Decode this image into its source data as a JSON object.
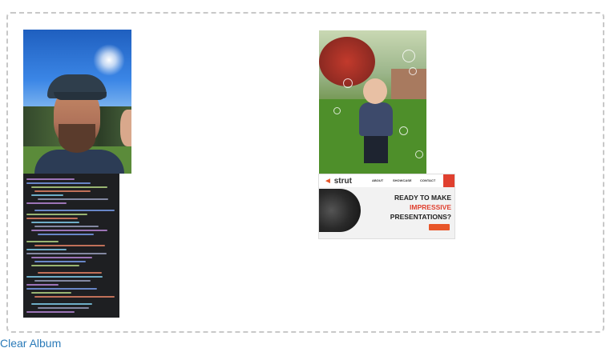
{
  "album": {
    "photos": [
      {
        "kind": "photo",
        "subject": "man-selfie"
      },
      {
        "kind": "photo",
        "subject": "toddler-bubbles"
      },
      {
        "kind": "screenshot",
        "subject": "code-editor"
      },
      {
        "kind": "screenshot",
        "subject": "strut-website"
      }
    ],
    "clear_label": "Clear Album"
  },
  "strut": {
    "logo": "strut",
    "nav": [
      "ABOUT",
      "SHOWCASE",
      "CONTACT"
    ],
    "headline_1": "READY TO MAKE",
    "headline_2": "IMPRESSIVE",
    "headline_3": "PRESENTATIONS?"
  },
  "colors": {
    "link": "#2a7ab8",
    "border": "#c8c8c8",
    "accent": "#e0402f"
  }
}
